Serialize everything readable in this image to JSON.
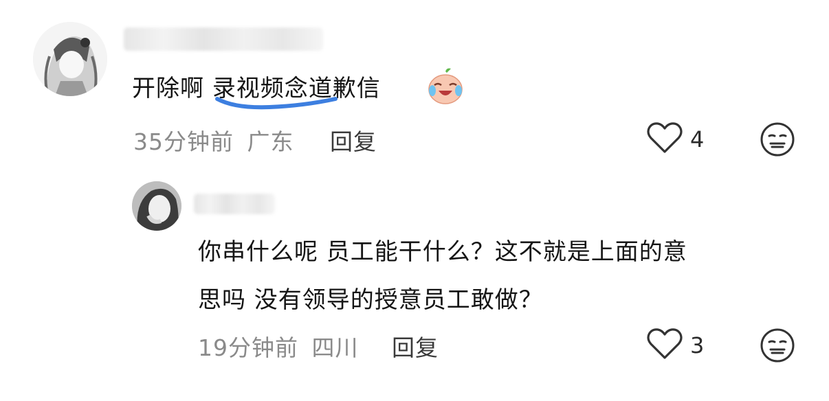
{
  "comments": [
    {
      "text_before": "开除啊 ",
      "highlight": "录视频念",
      "text_after": "道歉信",
      "emoji": "crying-laughing-face",
      "time": "35分钟前",
      "location": "广东",
      "reply_label": "回复",
      "likes": "4"
    },
    {
      "line1": "你串什么呢 员工能干什么？这不就是上面的意",
      "line2": "思吗 没有领导的授意员工敢做？",
      "time": "19分钟前",
      "location": "四川",
      "reply_label": "回复",
      "likes": "3"
    }
  ],
  "colors": {
    "highlight_underline": "#3d7fe0",
    "meta_gray": "#8a8a8a",
    "icon_stroke": "#333333"
  },
  "icons": [
    "heart-outline-icon",
    "neutral-face-icon",
    "laughing-crying-emoji"
  ]
}
